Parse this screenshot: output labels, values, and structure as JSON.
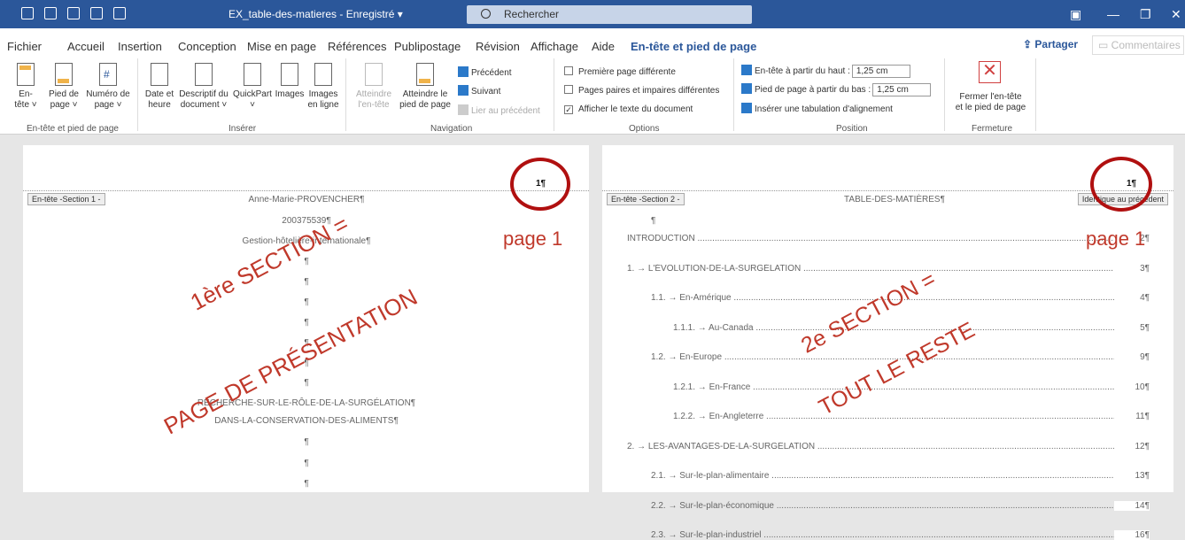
{
  "titlebar": {
    "doc_title": "EX_table-des-matieres - Enregistré ▾",
    "search_placeholder": "Rechercher"
  },
  "menu": {
    "tabs": [
      "Fichier",
      "Accueil",
      "Insertion",
      "Conception",
      "Mise en page",
      "Références",
      "Publipostage",
      "Révision",
      "Affichage",
      "Aide",
      "En-tête et pied de page"
    ],
    "share": "Partager",
    "comments": "Commentaires"
  },
  "ribbon": {
    "header_footer": {
      "entete_l1": "En-",
      "entete_l2": "tête ˅",
      "pied_l1": "Pied de",
      "pied_l2": "page ˅",
      "numero_l1": "Numéro de",
      "numero_l2": "page ˅",
      "group": "En-tête et pied de page"
    },
    "insert": {
      "date_l1": "Date et",
      "date_l2": "heure",
      "desc_l1": "Descriptif du",
      "desc_l2": "document ˅",
      "quickpart_l1": "QuickPart",
      "quickpart_l2": "˅",
      "images": "Images",
      "images_online_l1": "Images",
      "images_online_l2": "en ligne",
      "group": "Insérer"
    },
    "navigation": {
      "goto_header_l1": "Atteindre",
      "goto_header_l2": "l'en-tête",
      "goto_footer_l1": "Atteindre le",
      "goto_footer_l2": "pied de page",
      "previous": "Précédent",
      "next": "Suivant",
      "link_previous": "Lier au précédent",
      "group": "Navigation"
    },
    "options": {
      "first_page": "Première page différente",
      "odd_even": "Pages paires et impaires différentes",
      "show_text": "Afficher le texte du document",
      "group": "Options"
    },
    "position": {
      "header_from_top": "En-tête à partir du haut :",
      "header_value": "1,25 cm",
      "footer_from_bottom": "Pied de page à partir du bas :",
      "footer_value": "1,25 cm",
      "insert_tab": "Insérer une tabulation d'alignement",
      "group": "Position"
    },
    "close": {
      "label_l1": "Fermer l'en-tête",
      "label_l2": "et le pied de page",
      "group": "Fermeture"
    }
  },
  "page1": {
    "header_label": "En-tête -Section 1 -",
    "page_number": "1¶",
    "lines": [
      "Anne-Marie-PROVENCHER¶",
      "200375539¶",
      "Gestion-hôtelière-internationale¶",
      "¶",
      "¶",
      "¶",
      "¶",
      "¶",
      "¶",
      "¶",
      "RECHERCHE-SUR-LE-RÔLE-DE-LA-SURGÉLATION¶",
      "DANS-LA-CONSERVATION-DES-ALIMENTS¶",
      "¶",
      "¶",
      "¶"
    ]
  },
  "page2": {
    "header_label": "En-tête -Section 2 -",
    "same_as_previous": "Identique au précédent",
    "title": "TABLE-DES-MATIÈRES¶",
    "page_number": "1¶",
    "pilcrow": "¶",
    "toc": [
      {
        "text": "INTRODUCTION",
        "page": "2¶"
      },
      {
        "text": "1. → L'ÉVOLUTION-DE-LA-SURGÉLATION",
        "page": "3¶"
      },
      {
        "text": "1.1. → En-Amérique",
        "page": "4¶"
      },
      {
        "text": "1.1.1. → Au-Canada",
        "page": "5¶"
      },
      {
        "text": "1.2. → En-Europe",
        "page": "9¶"
      },
      {
        "text": "1.2.1. → En-France",
        "page": "10¶"
      },
      {
        "text": "1.2.2. → En-Angleterre",
        "page": "11¶"
      },
      {
        "text": "2. → LES-AVANTAGES-DE-LA-SURGÉLATION",
        "page": "12¶"
      },
      {
        "text": "2.1. → Sur-le-plan-alimentaire",
        "page": "13¶"
      },
      {
        "text": "2.2. → Sur-le-plan-économique",
        "page": "14¶"
      },
      {
        "text": "2.3. → Sur-le-plan-industriel",
        "page": "16¶"
      }
    ]
  },
  "annotations": {
    "page_label_1": "page 1",
    "page_label_2": "page 1",
    "section1_l1": "1ère SECTION =",
    "section1_l2": "PAGE DE PRÉSENTATION",
    "section2_l1": "2e SECTION =",
    "section2_l2": "TOUT LE RESTE",
    "color": "#c0392b"
  }
}
